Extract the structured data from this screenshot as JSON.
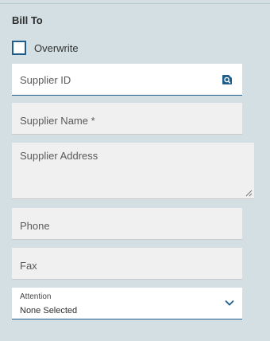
{
  "section": {
    "title": "Bill To"
  },
  "overwrite": {
    "label": "Overwrite",
    "checked": false
  },
  "fields": {
    "supplier_id": {
      "placeholder": "Supplier ID",
      "value": ""
    },
    "supplier_name": {
      "placeholder": "Supplier Name *",
      "value": ""
    },
    "supplier_address": {
      "placeholder": "Supplier Address",
      "value": ""
    },
    "phone": {
      "placeholder": "Phone",
      "value": ""
    },
    "fax": {
      "placeholder": "Fax",
      "value": ""
    },
    "attention": {
      "label": "Attention",
      "selected": "None Selected"
    }
  },
  "icons": {
    "lookup": "search-lookup-icon",
    "dropdown": "chevron-down-icon",
    "resize": "resize-grip-icon"
  },
  "colors": {
    "accent": "#1f5d8a",
    "page_bg": "#d3dfe3",
    "field_bg": "#f0f0f0"
  }
}
